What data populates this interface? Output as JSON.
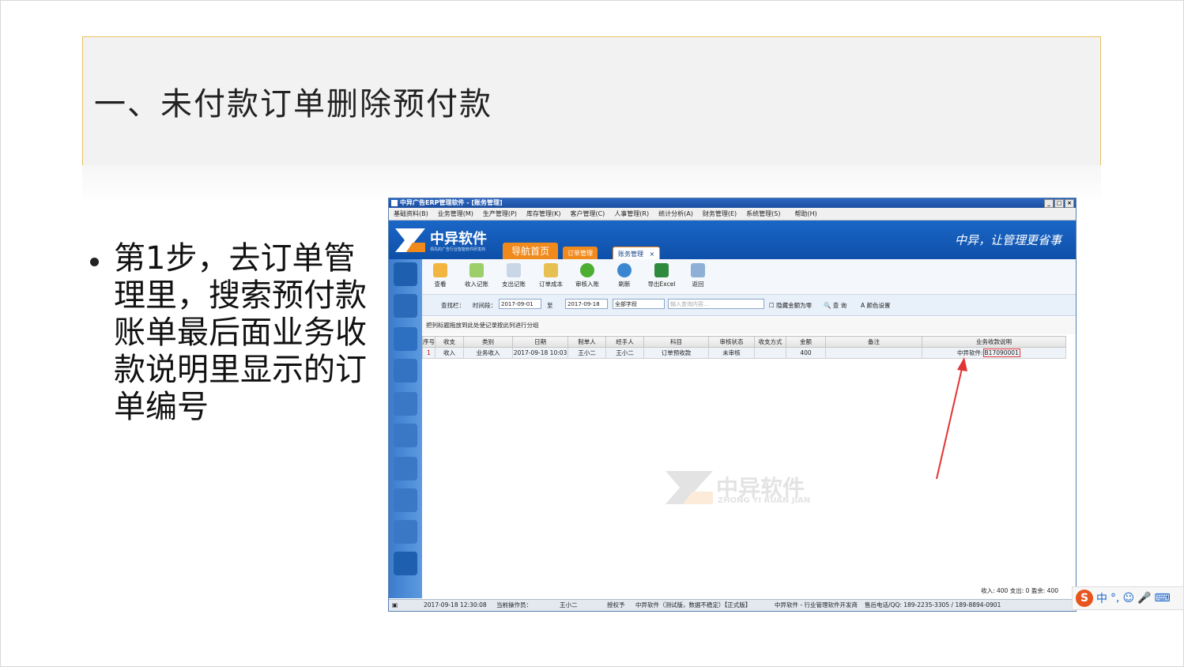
{
  "slide": {
    "title": "一、未付款订单删除预付款",
    "bullet": "第1步，去订单管理里，搜索预付款账单最后面业务收款说明里显示的订单编号"
  },
  "app": {
    "window_title": "中异广告ERP管理软件 - [账务管理]",
    "window_buttons": [
      "_",
      "□",
      "×"
    ],
    "menu": [
      "基础资料(B)",
      "业务管理(M)",
      "生产管理(P)",
      "库存管理(K)",
      "客户管理(C)",
      "人事管理(R)",
      "统计分析(A)",
      "财务管理(E)",
      "系统管理(S)",
      "帮助(H)"
    ],
    "brand_name": "中异软件",
    "brand_sub": "领先的广告行业智能软件研发商",
    "nav_home": "导航首页",
    "tabs": [
      "订单管理",
      "账务管理"
    ],
    "tab_close": "×",
    "slogan": "中异，让管理更省事",
    "toolbar": [
      "查看",
      "收入记账",
      "支出记账",
      "订单成本",
      "审核入账",
      "刷新",
      "导出Excel",
      "返回"
    ],
    "search": {
      "label": "查找栏：",
      "time_label": "时间段：",
      "date_from": "2017-09-01",
      "to": "至",
      "date_to": "2017-09-18",
      "field": "全部字段",
      "placeholder": "输入查询内容...",
      "hide_zero": "隐藏金额为零",
      "query": "查 询",
      "color_setting": "颜色设置"
    },
    "group_hint": "把列标题拖放到此处使记录按此列进行分组",
    "columns": [
      "序号",
      "收支",
      "类别",
      "日期",
      "制单人",
      "经手人",
      "科目",
      "审核状态",
      "收支方式",
      "金额",
      "备注",
      "业务收款说明"
    ],
    "rows": [
      {
        "no": "1",
        "type": "收入",
        "category": "业务收入",
        "date": "2017-09-18 10:03",
        "maker": "王小二",
        "handler": "王小二",
        "subject": "订单预收款",
        "status": "未审核",
        "method": "",
        "amount": "400",
        "remark": "",
        "desc_prefix": "中异软件:",
        "desc_order": "B17090001"
      }
    ],
    "watermark_cn": "中异软件",
    "watermark_en": "ZHONG YI RUAN JIAN",
    "summary": "收入: 400    支出: 0    盈余: 400",
    "status_bar": {
      "datetime": "2017-09-18 12:30:08",
      "operator_label": "当前操作员：",
      "operator": "王小二",
      "license": "授权予",
      "version": "中异软件（测试版，数据不稳定）【正式版】",
      "vendor": "中异软件 - 行业管理软件开发商",
      "hotline": "售后电话/QQ: 189-2235-3305 / 189-8894-0901"
    },
    "colors": {
      "accent": "#f08a1c",
      "banner": "#1b66c6",
      "highlight": "#e23434"
    }
  },
  "ime": {
    "logo": "S",
    "mode": "中",
    "punct": "°,",
    "emoji": "☺",
    "mic": "🎤",
    "kbd": "⌨"
  }
}
